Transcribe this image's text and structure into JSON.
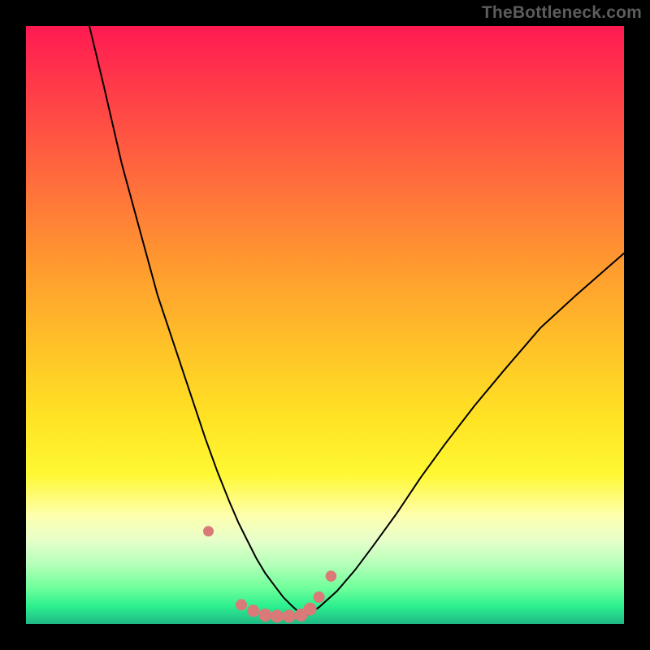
{
  "watermark": "TheBottleneck.com",
  "chart_data": {
    "type": "line",
    "title": "",
    "xlabel": "",
    "ylabel": "",
    "xlim": [
      0,
      100
    ],
    "ylim": [
      0,
      100
    ],
    "note": "Axes are unlabeled in the image; x/y values are in percent of plot width/height, with y=0 at bottom. Curves estimated from pixels.",
    "series": [
      {
        "name": "left curve",
        "x": [
          10.6,
          13.0,
          16.0,
          19.0,
          22.0,
          25.0,
          28.0,
          30.0,
          32.0,
          34.0,
          35.5,
          37.0,
          38.5,
          40.0,
          41.5,
          43.0,
          44.5,
          46.5
        ],
        "y": [
          100.0,
          90.0,
          77.0,
          66.0,
          55.0,
          46.0,
          37.0,
          31.0,
          25.5,
          20.5,
          17.0,
          14.0,
          11.0,
          8.5,
          6.5,
          4.5,
          3.0,
          1.2
        ]
      },
      {
        "name": "right curve",
        "x": [
          46.5,
          49.0,
          52.0,
          55.0,
          58.0,
          62.0,
          66.0,
          70.0,
          75.0,
          80.0,
          86.0,
          92.0,
          100.0
        ],
        "y": [
          1.2,
          2.8,
          5.5,
          9.0,
          13.0,
          18.5,
          24.5,
          30.0,
          36.5,
          42.5,
          49.5,
          55.0,
          62.0
        ]
      }
    ],
    "points": {
      "name": "highlight dots",
      "x": [
        30.5,
        36.0,
        38.0,
        40.0,
        42.0,
        44.0,
        46.0,
        47.5,
        49.0,
        51.0
      ],
      "y": [
        15.5,
        3.2,
        2.2,
        1.5,
        1.3,
        1.3,
        1.5,
        2.5,
        4.5,
        8.0
      ],
      "r": [
        6.5,
        7.0,
        7.5,
        8.0,
        8.0,
        8.0,
        8.0,
        8.0,
        7.0,
        6.8
      ]
    },
    "gradient_bands": [
      {
        "name": "red",
        "from_y": 100,
        "to_y": 70
      },
      {
        "name": "orange",
        "from_y": 70,
        "to_y": 45
      },
      {
        "name": "yellow",
        "from_y": 45,
        "to_y": 18
      },
      {
        "name": "pale",
        "from_y": 18,
        "to_y": 8
      },
      {
        "name": "green",
        "from_y": 8,
        "to_y": 0
      }
    ]
  }
}
